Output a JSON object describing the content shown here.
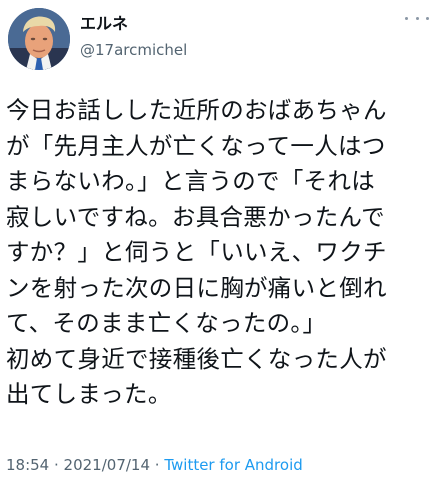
{
  "author": {
    "display_name": "エルネ",
    "handle": "@17arcmichel"
  },
  "more_icon": "more-horizontal-icon",
  "tweet": {
    "lines": [
      "今日お話しした近所のおばあちゃん",
      "が「先月主人が亡くなって一人はつ",
      "まらないわ。」と言うので「それは",
      "寂しいですね。お具合悪かったんで",
      "すか？」と伺うと「いいえ、ワクチ",
      "ンを射った次の日に胸が痛いと倒れ",
      "て、そのまま亡くなったの。」",
      "初めて身近で接種後亡くなった人が",
      "出てしまった。"
    ]
  },
  "meta": {
    "time": "18:54",
    "separator1": " · ",
    "date": "2021/07/14",
    "separator2": " · ",
    "source": "Twitter for Android"
  },
  "colors": {
    "text": "#0f1419",
    "secondary": "#536471",
    "link": "#1d9bf0"
  }
}
